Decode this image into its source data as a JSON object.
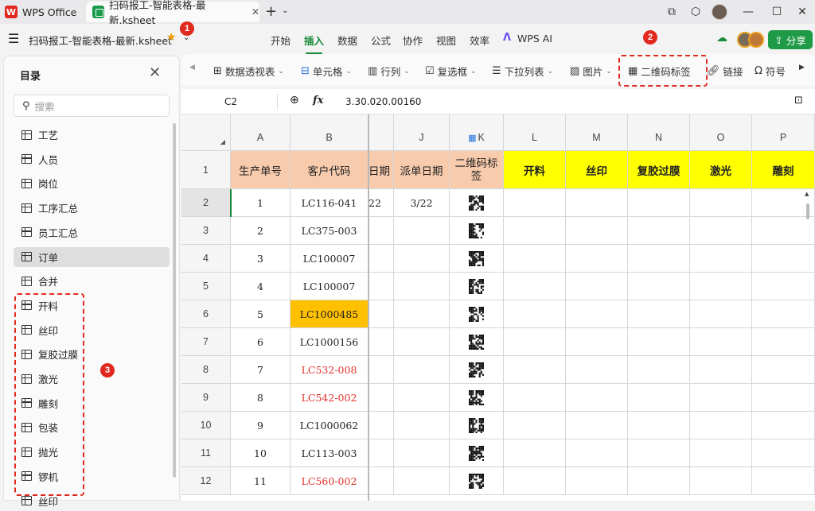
{
  "titlebar": {
    "app_tab": "WPS Office",
    "file_tab": "扫码报工-智能表格-最新.ksheet",
    "close_glyph": "✕",
    "new_tab_glyph": "+"
  },
  "menubar": {
    "doc_title": "扫码报工-智能表格-最新.ksheet",
    "items": [
      "开始",
      "插入",
      "数据",
      "公式",
      "协作",
      "视图",
      "效率",
      "WPS AI"
    ],
    "active": "插入",
    "share_label": "分享"
  },
  "ribbon": {
    "items": [
      "数据透视表",
      "单元格",
      "行列",
      "复选框",
      "下拉列表",
      "图片",
      "二维码标签",
      "链接",
      "符号"
    ]
  },
  "formula": {
    "cell_ref": "C2",
    "fx": "fx",
    "value": "3.30.020.00160"
  },
  "sidebar": {
    "title": "目录",
    "search_placeholder": "搜索",
    "selected": "订单",
    "items": [
      "工艺",
      "人员",
      "岗位",
      "工序汇总",
      "员工汇总",
      "订单",
      "合并",
      "开料",
      "丝印",
      "复胶过膜",
      "激光",
      "雕刻",
      "包装",
      "抛光",
      "锣机",
      "丝印"
    ]
  },
  "grid": {
    "columns": [
      "A",
      "B",
      "",
      "J",
      "K",
      "L",
      "M",
      "N",
      "O",
      "P"
    ],
    "header_row": {
      "A": "生产单号",
      "B": "客户代码",
      "partial": "日期",
      "J": "派单日期",
      "K": "二维码标签",
      "L": "开料",
      "M": "丝印",
      "N": "复胶过膜",
      "O": "激光",
      "P": "雕刻"
    },
    "rows": [
      {
        "num": "2",
        "a": "1",
        "b": "LC116-041",
        "partial": "22",
        "j": "3/22",
        "b_style": "normal"
      },
      {
        "num": "3",
        "a": "2",
        "b": "LC375-003",
        "partial": "",
        "j": "",
        "b_style": "normal"
      },
      {
        "num": "4",
        "a": "3",
        "b": "LC100007",
        "partial": "",
        "j": "",
        "b_style": "normal"
      },
      {
        "num": "5",
        "a": "4",
        "b": "LC100007",
        "partial": "",
        "j": "",
        "b_style": "normal"
      },
      {
        "num": "6",
        "a": "5",
        "b": "LC1000485",
        "partial": "",
        "j": "",
        "b_style": "highlight"
      },
      {
        "num": "7",
        "a": "6",
        "b": "LC1000156",
        "partial": "",
        "j": "",
        "b_style": "normal"
      },
      {
        "num": "8",
        "a": "7",
        "b": "LC532-008",
        "partial": "",
        "j": "",
        "b_style": "red"
      },
      {
        "num": "9",
        "a": "8",
        "b": "LC542-002",
        "partial": "",
        "j": "",
        "b_style": "red"
      },
      {
        "num": "10",
        "a": "9",
        "b": "LC1000062",
        "partial": "",
        "j": "",
        "b_style": "normal"
      },
      {
        "num": "11",
        "a": "10",
        "b": "LC113-003",
        "partial": "",
        "j": "",
        "b_style": "normal"
      },
      {
        "num": "12",
        "a": "11",
        "b": "LC560-002",
        "partial": "",
        "j": "",
        "b_style": "red"
      }
    ],
    "header_row_num": "1"
  },
  "annotations": [
    "1",
    "2",
    "3"
  ],
  "colors": {
    "accent": "#1a8a3b",
    "header_peach": "#f8cbad",
    "header_yellow": "#ffff00",
    "highlight": "#ffc000",
    "red_text": "#e0302a",
    "annotation": "#e02a1f"
  }
}
